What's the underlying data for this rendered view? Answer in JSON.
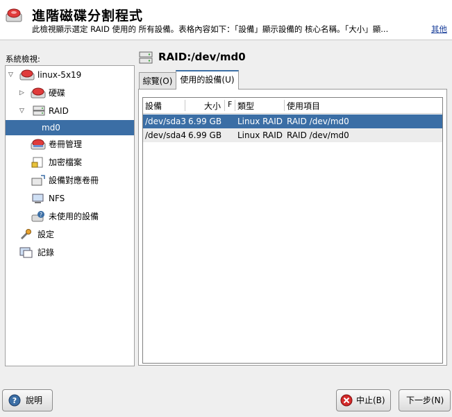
{
  "header": {
    "title": "進階磁碟分割程式",
    "subtitle": "此檢視顯示選定 RAID 使用的 所有設備。表格內容如下：「設備」顯示設備的 核心名稱。「大小」顯...",
    "more_link": "其他"
  },
  "tree": {
    "label": "系統檢視:",
    "items": [
      {
        "label": "linux-5x19",
        "icon": "disk-drive-icon"
      },
      {
        "label": "硬碟",
        "icon": "harddisk-icon"
      },
      {
        "label": "RAID",
        "icon": "raid-icon"
      },
      {
        "label": "md0",
        "icon": ""
      },
      {
        "label": "卷冊管理",
        "icon": "volume-manager-icon"
      },
      {
        "label": "加密檔案",
        "icon": "encrypted-file-icon"
      },
      {
        "label": "設備對應卷冊",
        "icon": "device-mapper-icon"
      },
      {
        "label": "NFS",
        "icon": "nfs-icon"
      },
      {
        "label": "未使用的設備",
        "icon": "unused-devices-icon"
      },
      {
        "label": "設定",
        "icon": "settings-wrench-icon"
      },
      {
        "label": "記錄",
        "icon": "log-icon"
      }
    ]
  },
  "panel": {
    "title": "RAID:/dev/md0",
    "tabs": [
      {
        "label": "綜覽(O)"
      },
      {
        "label": "使用的設備(U)"
      }
    ],
    "table": {
      "headers": [
        "設備",
        "大小",
        "F",
        "類型",
        "使用項目"
      ],
      "rows": [
        [
          "/dev/sda3",
          "6.99 GB",
          "",
          "Linux RAID",
          "RAID /dev/md0"
        ],
        [
          "/dev/sda4",
          "6.99 GB",
          "",
          "Linux RAID",
          "RAID /dev/md0"
        ]
      ]
    }
  },
  "buttons": {
    "help": "說明",
    "abort": "中止(B)",
    "next": "下一步(N)"
  },
  "colors": {
    "selection": "#3b6ea5",
    "link": "#1a3f9a"
  }
}
